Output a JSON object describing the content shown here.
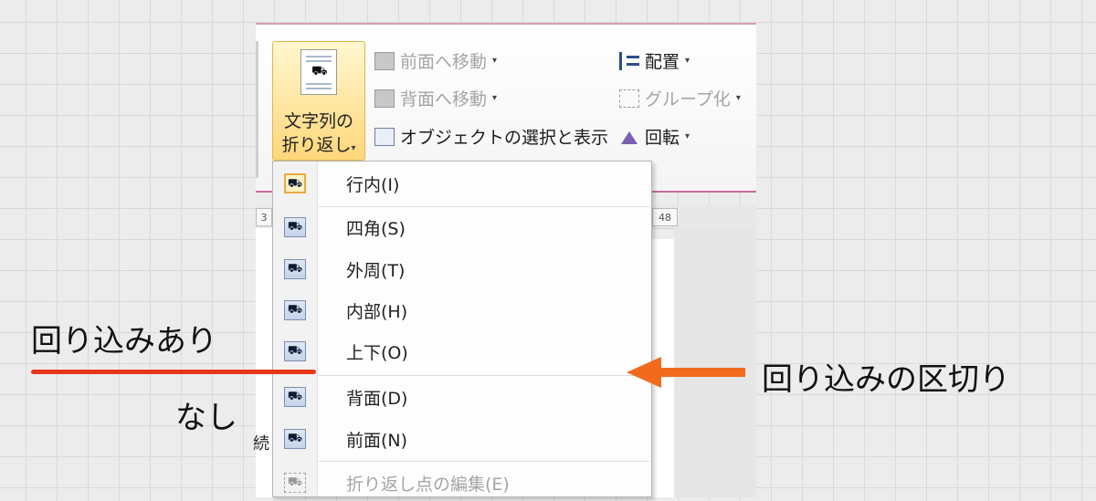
{
  "ribbon": {
    "wrap_button": {
      "line1": "文字列の",
      "line2": "折り返し",
      "caret": "▾"
    },
    "commands": [
      {
        "label": "前面へ移動",
        "caret": "▾",
        "icon": "bring-forward-icon",
        "enabled": false
      },
      {
        "label": "背面へ移動",
        "caret": "▾",
        "icon": "send-backward-icon",
        "enabled": false
      },
      {
        "label": "オブジェクトの選択と表示",
        "caret": "",
        "icon": "selection-pane-icon",
        "enabled": true
      },
      {
        "label": "配置",
        "caret": "▾",
        "icon": "align-icon",
        "enabled": true
      },
      {
        "label": "グループ化",
        "caret": "▾",
        "icon": "group-icon",
        "enabled": false
      },
      {
        "label": "回転",
        "caret": "▾",
        "icon": "rotate-icon",
        "enabled": true
      }
    ]
  },
  "menu": {
    "items": [
      {
        "label": "行内(I)",
        "icon": "wrap-inline-icon",
        "checked": true,
        "enabled": true
      },
      {
        "label": "四角(S)",
        "icon": "wrap-square-icon",
        "checked": false,
        "enabled": true
      },
      {
        "label": "外周(T)",
        "icon": "wrap-tight-icon",
        "checked": false,
        "enabled": true
      },
      {
        "label": "内部(H)",
        "icon": "wrap-through-icon",
        "checked": false,
        "enabled": true
      },
      {
        "label": "上下(O)",
        "icon": "wrap-top-bottom-icon",
        "checked": false,
        "enabled": true
      },
      {
        "label": "背面(D)",
        "icon": "wrap-behind-text-icon",
        "checked": false,
        "enabled": true
      },
      {
        "label": "前面(N)",
        "icon": "wrap-in-front-icon",
        "checked": false,
        "enabled": true
      },
      {
        "label": "折り返し点の編集(E)",
        "icon": "edit-wrap-points-icon",
        "checked": false,
        "enabled": false
      }
    ]
  },
  "ruler": {
    "left_mark": "3",
    "right_mark": "48"
  },
  "document": {
    "fragment": "続"
  },
  "annotations": {
    "with_wrap": "回り込みあり",
    "without_wrap": "なし",
    "divider_label": "回り込みの区切り",
    "red_color": "#e8361a",
    "arrow_color": "#f26b1d"
  }
}
